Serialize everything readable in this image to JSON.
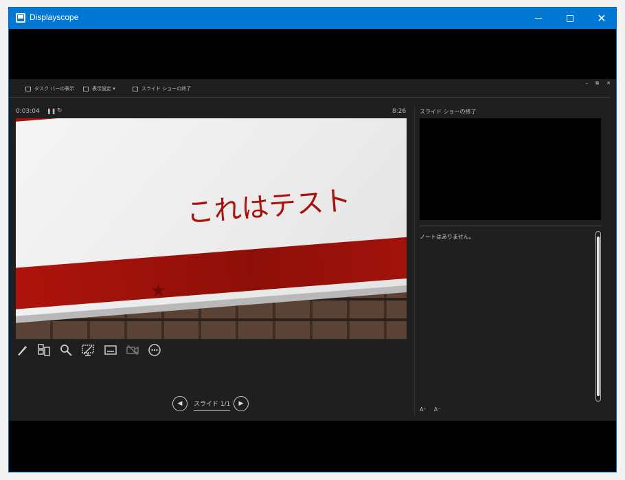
{
  "window": {
    "title": "Displayscope"
  },
  "presenter": {
    "toolbar": {
      "taskbar_label": "タスク バーの表示",
      "display_settings_label": "表示設定 ▾",
      "end_show_label": "スライド ショーの終了"
    },
    "window_controls": [
      "–",
      "⧉",
      "✕"
    ],
    "timer": "0:03:04",
    "clock": "8:26",
    "current_slide": {
      "title": "これはテスト"
    },
    "navigation": {
      "slide_count": "スライド 1/1"
    },
    "next_slide_label": "スライド ショーの終了",
    "notes_text": "ノートはありません。",
    "font_buttons": [
      "A⁺",
      "A⁻"
    ]
  },
  "icons": {
    "tools": [
      "pen-icon",
      "see-all-slides-icon",
      "zoom-icon",
      "black-screen-icon",
      "subtitles-icon",
      "camera-off-icon",
      "more-options-icon"
    ]
  }
}
